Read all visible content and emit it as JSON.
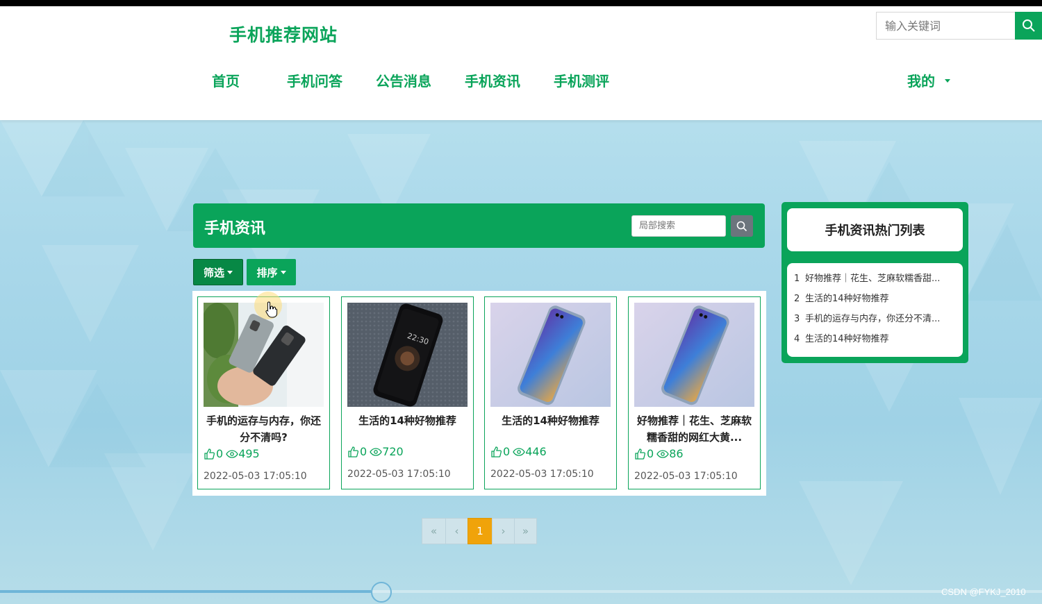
{
  "site": {
    "title": "手机推荐网站"
  },
  "search": {
    "placeholder": "输入关键词"
  },
  "nav": {
    "items": [
      "首页",
      "手机问答",
      "公告消息",
      "手机资讯",
      "手机测评"
    ],
    "mine": "我的"
  },
  "section": {
    "title": "手机资讯",
    "local_search_placeholder": "局部搜索",
    "filter_label": "筛选",
    "sort_label": "排序"
  },
  "cards": [
    {
      "title": "手机的运存与内存，你还分不清吗?",
      "likes": "0",
      "views": "495",
      "date": "2022-05-03 17:05:10"
    },
    {
      "title": "生活的14种好物推荐",
      "likes": "0",
      "views": "720",
      "date": "2022-05-03 17:05:10"
    },
    {
      "title": "生活的14种好物推荐",
      "likes": "0",
      "views": "446",
      "date": "2022-05-03 17:05:10"
    },
    {
      "title": "好物推荐｜花生、芝麻软糯香甜的网红大黄...",
      "likes": "0",
      "views": "86",
      "date": "2022-05-03 17:05:10"
    }
  ],
  "hot": {
    "title": "手机资讯热门列表",
    "items": [
      {
        "num": "1",
        "text": "好物推荐｜花生、芝麻软糯香甜..."
      },
      {
        "num": "2",
        "text": "生活的14种好物推荐"
      },
      {
        "num": "3",
        "text": "手机的运存与内存，你还分不清..."
      },
      {
        "num": "4",
        "text": "生活的14种好物推荐"
      }
    ]
  },
  "pager": {
    "first": "«",
    "prev": "‹",
    "current": "1",
    "next": "›",
    "last": "»"
  },
  "video": {
    "progress": 0.356
  },
  "watermark": "CSDN @FYKJ_2010",
  "colors": {
    "brand": "#0aa45a",
    "active_page": "#f0a30a"
  }
}
